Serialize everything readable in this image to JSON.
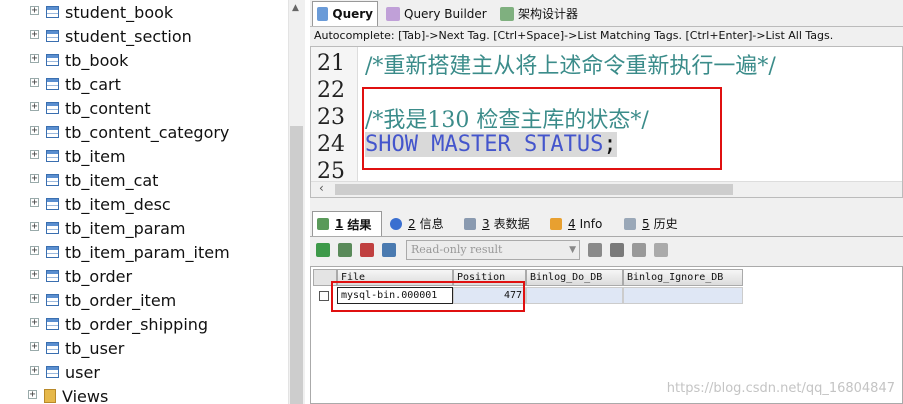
{
  "tree": {
    "items": [
      {
        "label": "student_book"
      },
      {
        "label": "student_section"
      },
      {
        "label": "tb_book"
      },
      {
        "label": "tb_cart"
      },
      {
        "label": "tb_content"
      },
      {
        "label": "tb_content_category"
      },
      {
        "label": "tb_item"
      },
      {
        "label": "tb_item_cat"
      },
      {
        "label": "tb_item_desc"
      },
      {
        "label": "tb_item_param"
      },
      {
        "label": "tb_item_param_item"
      },
      {
        "label": "tb_order"
      },
      {
        "label": "tb_order_item"
      },
      {
        "label": "tb_order_shipping"
      },
      {
        "label": "tb_user"
      },
      {
        "label": "user"
      }
    ],
    "views_label": "Views"
  },
  "tabs": {
    "query": "Query",
    "query_builder": "Query Builder",
    "schema_designer": "架构设计器"
  },
  "autocomplete": "Autocomplete: [Tab]->Next Tag. [Ctrl+Space]->List Matching Tags. [Ctrl+Enter]->List All Tags.",
  "editor": {
    "lines": [
      {
        "num": "21",
        "text": "/*重新搭建主从将上述命令重新执行一遍*/"
      },
      {
        "num": "22",
        "text": ""
      },
      {
        "num": "23",
        "text": "/*我是130 检查主库的状态*/"
      },
      {
        "num": "24",
        "text": "SHOW MASTER STATUS",
        "semi": ";"
      },
      {
        "num": "25",
        "text": ""
      }
    ]
  },
  "result_tabs": {
    "result": {
      "num": "1",
      "label": "结果"
    },
    "info": {
      "num": "2",
      "label": "信息"
    },
    "table_data": {
      "num": "3",
      "label": "表数据"
    },
    "info2": {
      "num": "4",
      "label": "Info"
    },
    "history": {
      "num": "5",
      "label": "历史"
    }
  },
  "toolbar": {
    "readonly_label": "Read-only result"
  },
  "grid": {
    "columns": [
      "File",
      "Position",
      "Binlog_Do_DB",
      "Binlog_Ignore_DB"
    ],
    "rows": [
      {
        "file": "mysql-bin.000001",
        "position": "477",
        "do_db": "",
        "ignore_db": ""
      }
    ]
  },
  "watermark": "https://blog.csdn.net/qq_16804847"
}
